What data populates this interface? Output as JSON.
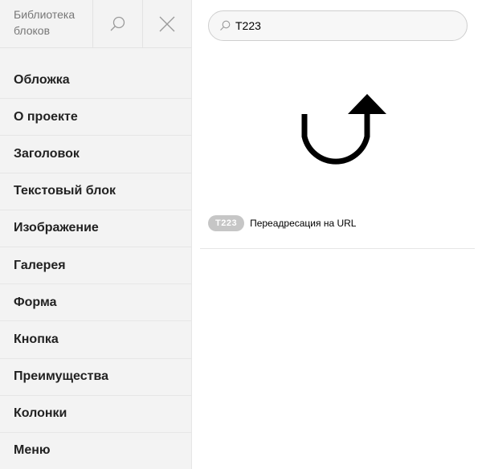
{
  "sidebar": {
    "title": "Библиотека\nблоков",
    "search_icon": "search-icon",
    "close_icon": "close-icon",
    "items": [
      {
        "label": "Обложка"
      },
      {
        "label": "О проекте"
      },
      {
        "label": "Заголовок"
      },
      {
        "label": "Текстовый блок"
      },
      {
        "label": "Изображение"
      },
      {
        "label": "Галерея"
      },
      {
        "label": "Форма"
      },
      {
        "label": "Кнопка"
      },
      {
        "label": "Преимущества"
      },
      {
        "label": "Колонки"
      },
      {
        "label": "Меню"
      }
    ]
  },
  "search": {
    "value": "T223",
    "placeholder": ""
  },
  "results": [
    {
      "code": "T223",
      "name": "Переадресация на URL",
      "icon": "redirect-arrow-icon"
    }
  ],
  "colors": {
    "sidebar_bg": "#f3f3f3",
    "code_badge": "#c6c6c6"
  }
}
